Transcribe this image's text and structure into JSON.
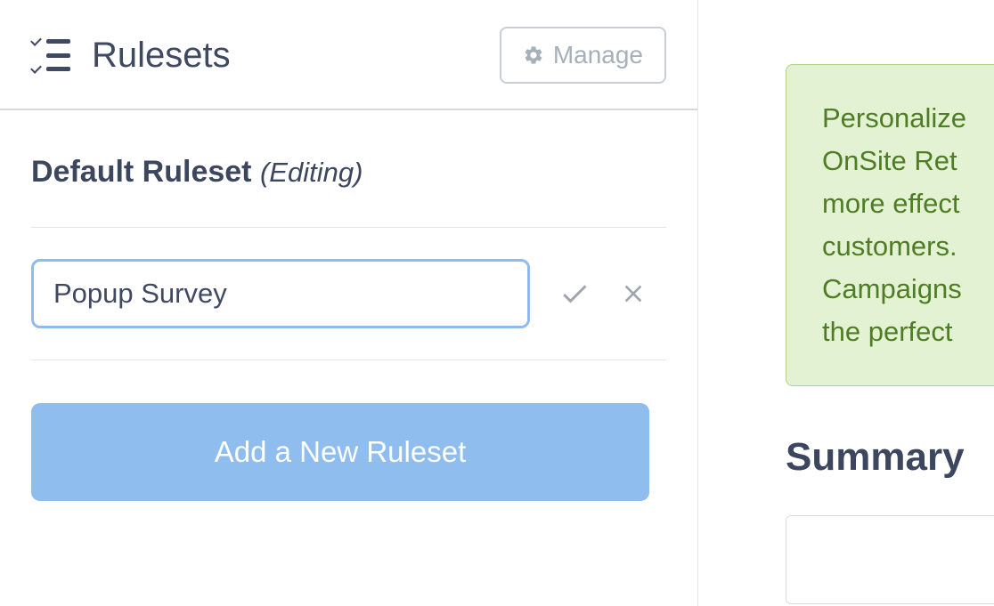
{
  "header": {
    "title": "Rulesets",
    "manage_label": "Manage"
  },
  "ruleset": {
    "name": "Default Ruleset",
    "status": "(Editing)",
    "input_value": "Popup Survey"
  },
  "actions": {
    "add_new_label": "Add a New Ruleset"
  },
  "sidebar": {
    "info_lines": [
      "Personalize",
      "OnSite Ret",
      "more effect",
      "customers.",
      "Campaigns",
      "the perfect"
    ],
    "summary_heading": "Summary"
  }
}
